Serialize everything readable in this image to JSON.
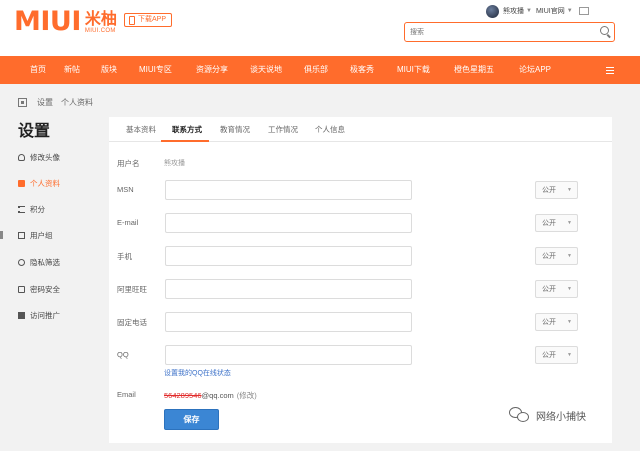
{
  "header": {
    "logo_main": "MIUI",
    "logo_cn": "米柚",
    "logo_sub": "MIUI.COM",
    "download_app": "下载APP",
    "username": "熊攻播",
    "official_site": "MIUI官网",
    "search_placeholder": "搜索"
  },
  "nav": {
    "items": [
      "首页",
      "新帖",
      "版块",
      "MIUI专区",
      "资源分享",
      "谈天说地",
      "俱乐部",
      "极客秀",
      "MIUI下载",
      "橙色星期五",
      "论坛APP"
    ],
    "menu_icon": "menu-icon"
  },
  "breadcrumb": [
    "设置",
    "个人资料"
  ],
  "sidebar": {
    "title": "设置",
    "items": [
      {
        "label": "修改头像",
        "icon": "person-icon"
      },
      {
        "label": "个人资料",
        "icon": "card-icon",
        "active": true
      },
      {
        "label": "积分",
        "icon": "list-icon"
      },
      {
        "label": "用户组",
        "icon": "group-icon"
      },
      {
        "label": "隐私筛选",
        "icon": "key-icon"
      },
      {
        "label": "密码安全",
        "icon": "lock-icon"
      },
      {
        "label": "访问推广",
        "icon": "check-icon"
      }
    ]
  },
  "tabs": [
    "基本资料",
    "联系方式",
    "教育情况",
    "工作情况",
    "个人信息"
  ],
  "active_tab": "联系方式",
  "form": {
    "username_label": "用户名",
    "username_value": "熊攻播",
    "fields": [
      {
        "label": "MSN",
        "value": "",
        "privacy": "公开"
      },
      {
        "label": "E-mail",
        "value": "",
        "privacy": "公开"
      },
      {
        "label": "手机",
        "value": "",
        "privacy": "公开"
      },
      {
        "label": "阿里旺旺",
        "value": "",
        "privacy": "公开"
      },
      {
        "label": "固定电话",
        "value": "",
        "privacy": "公开"
      },
      {
        "label": "QQ",
        "value": "",
        "privacy": "公开"
      }
    ],
    "qq_link": "设置我的QQ在线状态",
    "email_label": "Email",
    "email_redacted": "564289546",
    "email_domain": "@qq.com",
    "email_change": "(修改)",
    "save_button": "保存"
  },
  "watermark": {
    "text": "网络小捕快"
  },
  "colors": {
    "brand": "#ff6c2c",
    "link": "#3d72c9",
    "button": "#3b86d4"
  }
}
